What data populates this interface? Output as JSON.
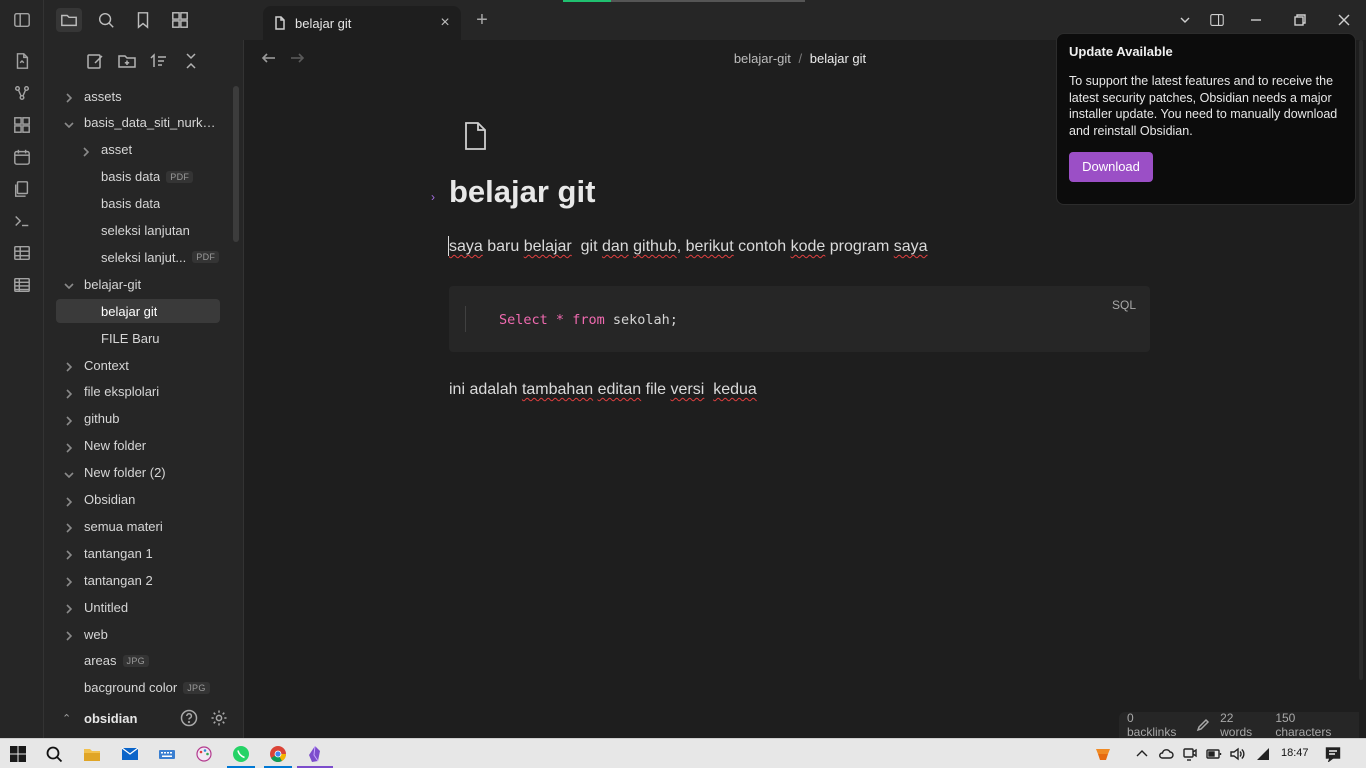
{
  "window": {
    "tab_title": "belajar git"
  },
  "sidebar": {
    "items": [
      {
        "label": "assets",
        "depth": 0,
        "type": "folder",
        "expanded": false,
        "badge": ""
      },
      {
        "label": "basis_data_siti_nurkh...",
        "depth": 0,
        "type": "folder",
        "expanded": true,
        "badge": ""
      },
      {
        "label": "asset",
        "depth": 1,
        "type": "folder",
        "expanded": false,
        "badge": ""
      },
      {
        "label": "basis data",
        "depth": 1,
        "type": "file",
        "badge": "PDF"
      },
      {
        "label": "basis data",
        "depth": 1,
        "type": "file",
        "badge": ""
      },
      {
        "label": "seleksi lanjutan",
        "depth": 1,
        "type": "file",
        "badge": ""
      },
      {
        "label": "seleksi lanjut...",
        "depth": 1,
        "type": "file",
        "badge": "PDF"
      },
      {
        "label": "belajar-git",
        "depth": 0,
        "type": "folder",
        "expanded": true,
        "badge": ""
      },
      {
        "label": "belajar git",
        "depth": 1,
        "type": "file",
        "badge": "",
        "selected": true
      },
      {
        "label": "FILE Baru",
        "depth": 1,
        "type": "file",
        "badge": ""
      },
      {
        "label": "Context",
        "depth": 0,
        "type": "folder",
        "expanded": false,
        "badge": ""
      },
      {
        "label": "file eksplolari",
        "depth": 0,
        "type": "folder",
        "expanded": false,
        "badge": ""
      },
      {
        "label": "github",
        "depth": 0,
        "type": "folder",
        "expanded": false,
        "badge": ""
      },
      {
        "label": "New folder",
        "depth": 0,
        "type": "folder",
        "expanded": false,
        "badge": ""
      },
      {
        "label": "New folder (2)",
        "depth": 0,
        "type": "folder",
        "expanded": true,
        "badge": ""
      },
      {
        "label": "Obsidian",
        "depth": 0,
        "type": "folder",
        "expanded": false,
        "badge": ""
      },
      {
        "label": "semua materi",
        "depth": 0,
        "type": "folder",
        "expanded": false,
        "badge": ""
      },
      {
        "label": "tantangan 1",
        "depth": 0,
        "type": "folder",
        "expanded": false,
        "badge": ""
      },
      {
        "label": "tantangan 2",
        "depth": 0,
        "type": "folder",
        "expanded": false,
        "badge": ""
      },
      {
        "label": "Untitled",
        "depth": 0,
        "type": "folder",
        "expanded": false,
        "badge": ""
      },
      {
        "label": "web",
        "depth": 0,
        "type": "folder",
        "expanded": false,
        "badge": ""
      },
      {
        "label": "areas",
        "depth": 0,
        "type": "file",
        "badge": "JPG"
      },
      {
        "label": "bacground color",
        "depth": 0,
        "type": "file",
        "badge": "JPG"
      }
    ],
    "vault_name": "obsidian"
  },
  "editor": {
    "breadcrumb_folder": "belajar-git",
    "breadcrumb_separator": "/",
    "breadcrumb_file": "belajar git",
    "title": "belajar git",
    "paragraph1": [
      {
        "text": "saya",
        "spell": true
      },
      {
        "text": " baru ",
        "spell": false
      },
      {
        "text": "belajar",
        "spell": true
      },
      {
        "text": "  git ",
        "spell": false
      },
      {
        "text": "dan",
        "spell": true
      },
      {
        "text": " ",
        "spell": false
      },
      {
        "text": "github",
        "spell": true
      },
      {
        "text": ", ",
        "spell": false
      },
      {
        "text": "berikut",
        "spell": true
      },
      {
        "text": " contoh ",
        "spell": false
      },
      {
        "text": "kode",
        "spell": true
      },
      {
        "text": " program ",
        "spell": false
      },
      {
        "text": "saya",
        "spell": true
      }
    ],
    "code": {
      "language": "SQL",
      "keyword1": "Select",
      "op": "*",
      "keyword2": "from",
      "rest": "sekolah;"
    },
    "paragraph2": [
      {
        "text": "ini adalah ",
        "spell": false
      },
      {
        "text": "tambahan",
        "spell": true
      },
      {
        "text": " ",
        "spell": false
      },
      {
        "text": "editan",
        "spell": true
      },
      {
        "text": " file ",
        "spell": false
      },
      {
        "text": "versi",
        "spell": true
      },
      {
        "text": "  ",
        "spell": false
      },
      {
        "text": "kedua",
        "spell": true
      }
    ]
  },
  "status": {
    "backlinks": "0 backlinks",
    "words": "22 words",
    "characters": "150 characters"
  },
  "notice": {
    "title": "Update Available",
    "body": "To support the latest features and to receive the latest security patches, Obsidian needs a major installer update. You need to manually download and reinstall Obsidian.",
    "button": "Download"
  },
  "taskbar": {
    "time": "18:47"
  },
  "colors": {
    "accent": "#9b4fc6",
    "code_keyword": "#f06ab0",
    "spellcheck": "#e04040"
  }
}
